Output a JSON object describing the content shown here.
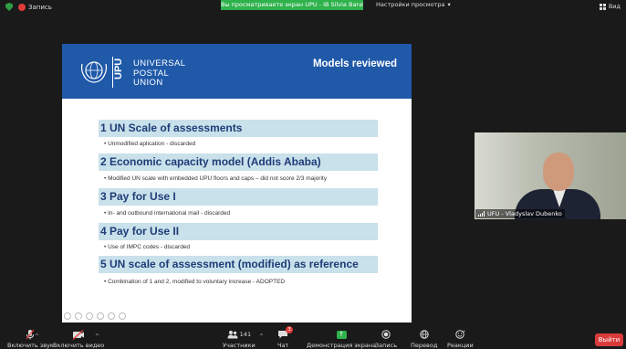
{
  "topbar": {
    "record_label": "Запись",
    "sharing_banner": "Вы просматриваете экран UPU - IB Silvia Baratech",
    "view_options_label": "Настройки просмотра",
    "view_button_label": "Вид"
  },
  "slide": {
    "org_line1": "UNIVERSAL",
    "org_line2": "POSTAL",
    "org_line3": "UNION",
    "org_abbrev": "UPU",
    "title": "Models reviewed",
    "models": [
      {
        "heading": "1 UN Scale of assessments",
        "bullet": "• Unmodified aplication - discarded"
      },
      {
        "heading": "2 Economic capacity model (Addis Ababa)",
        "bullet": "• Modified UN scale with embedded UPU floors and caps – did not score 2/3 majority"
      },
      {
        "heading": "3 Pay for Use I",
        "bullet": "• In- and outbound international mail - discarded"
      },
      {
        "heading": "4 Pay for Use II",
        "bullet": "• Use of IMPC codes - discarded"
      },
      {
        "heading": "5 UN scale of assessment (modified) as reference",
        "bullet": "• Combination of 1 and 2, modified to voluntary increase - ADOPTED"
      }
    ]
  },
  "participant_video": {
    "name": "UFU - Vladyslav Dubenko"
  },
  "toolbar": {
    "mute_label": "Включить звук",
    "video_label": "Включить видео",
    "participants_label": "Участники",
    "participants_count": "141",
    "chat_label": "Чат",
    "chat_badge": "3",
    "share_screen_label": "Демонстрация экрана",
    "record_label": "Запись",
    "translate_label": "Перевод",
    "reactions_label": "Реакции",
    "exit_label": "Выйти"
  },
  "colors": {
    "slide_header_blue": "#1f59a8",
    "model_box": "#c8e1ea",
    "model_text": "#1f3c78",
    "share_green": "#2fb24c",
    "exit_red": "#d93b3b"
  }
}
